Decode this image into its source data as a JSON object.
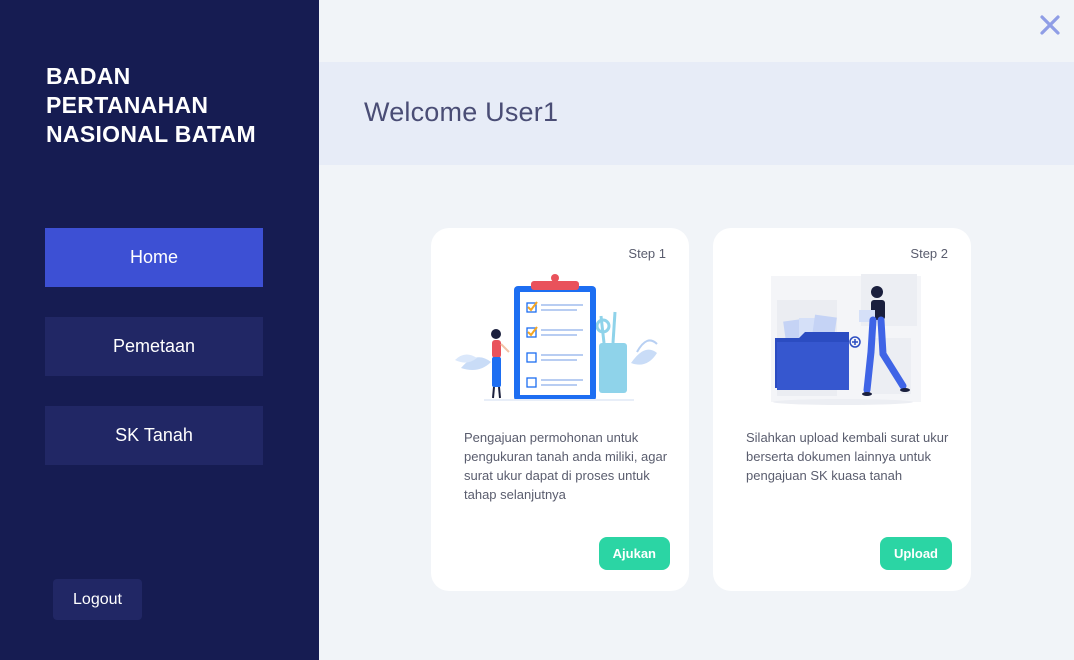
{
  "sidebar": {
    "brand": "BADAN PERTANAHAN NASIONAL BATAM",
    "nav": [
      {
        "label": "Home",
        "active": true
      },
      {
        "label": "Pemetaan",
        "active": false
      },
      {
        "label": "SK Tanah",
        "active": false
      }
    ],
    "logout_label": "Logout"
  },
  "header": {
    "welcome": "Welcome User1",
    "close_icon": "close-x-icon"
  },
  "cards": [
    {
      "step": "Step 1",
      "illustration": "checklist-clipboard-illustration",
      "description": "Pengajuan permohonan untuk pengukuran tanah anda miliki, agar surat ukur dapat di proses untuk tahap selanjutnya",
      "button_label": "Ajukan"
    },
    {
      "step": "Step 2",
      "illustration": "document-folder-illustration",
      "description": "Silahkan upload kembali surat ukur berserta dokumen lainnya untuk pengajuan SK kuasa tanah",
      "button_label": "Upload"
    }
  ],
  "colors": {
    "sidebar_bg": "#161c52",
    "nav_active": "#3d50d4",
    "nav_idle": "#212765",
    "accent_green": "#2bd5a4",
    "welcome_bar": "#e7ecf7"
  }
}
